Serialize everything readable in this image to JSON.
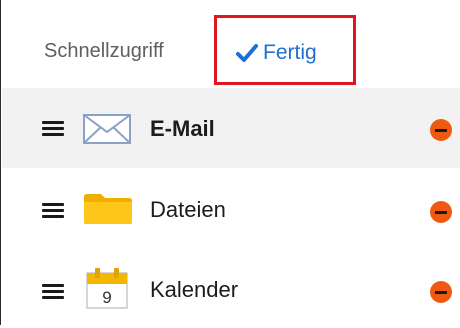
{
  "header": {
    "title": "Schnellzugriff",
    "done_label": "Fertig"
  },
  "items": [
    {
      "label": "E-Mail",
      "icon": "envelope-icon",
      "active": true
    },
    {
      "label": "Dateien",
      "icon": "folder-icon",
      "active": false
    },
    {
      "label": "Kalender",
      "icon": "calendar-icon",
      "active": false,
      "calendar_day": "9"
    }
  ],
  "colors": {
    "accent": "#1e6fd1",
    "highlight_border": "#e0151e",
    "remove": "#ee5a12",
    "folder": "#f5b800"
  }
}
